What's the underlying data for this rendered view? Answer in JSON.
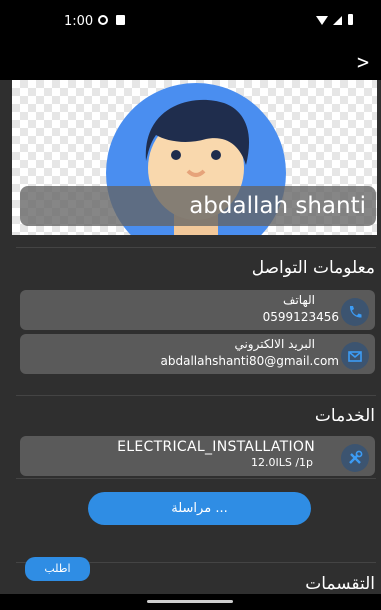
{
  "status_bar": {
    "time": "1:00"
  },
  "profile": {
    "name": "abdallah shanti"
  },
  "contact": {
    "title": "معلومات التواصل",
    "phone_label": "الهاتف",
    "phone_value": "0599123456",
    "email_label": "البريد الالكتروني",
    "email_value": "abdallahshanti80@gmail.com"
  },
  "services": {
    "title": "الخدمات",
    "items": [
      {
        "name": "ELECTRICAL_INSTALLATION",
        "price": "12.0ILS /1p"
      }
    ]
  },
  "actions": {
    "message_label": "مراسلة ...",
    "order_label": "اطلب"
  },
  "reviews": {
    "title": "التقسمات"
  },
  "colors": {
    "accent": "#2f8de4",
    "card": "#5a5a5a",
    "background": "#2f2f2f"
  }
}
